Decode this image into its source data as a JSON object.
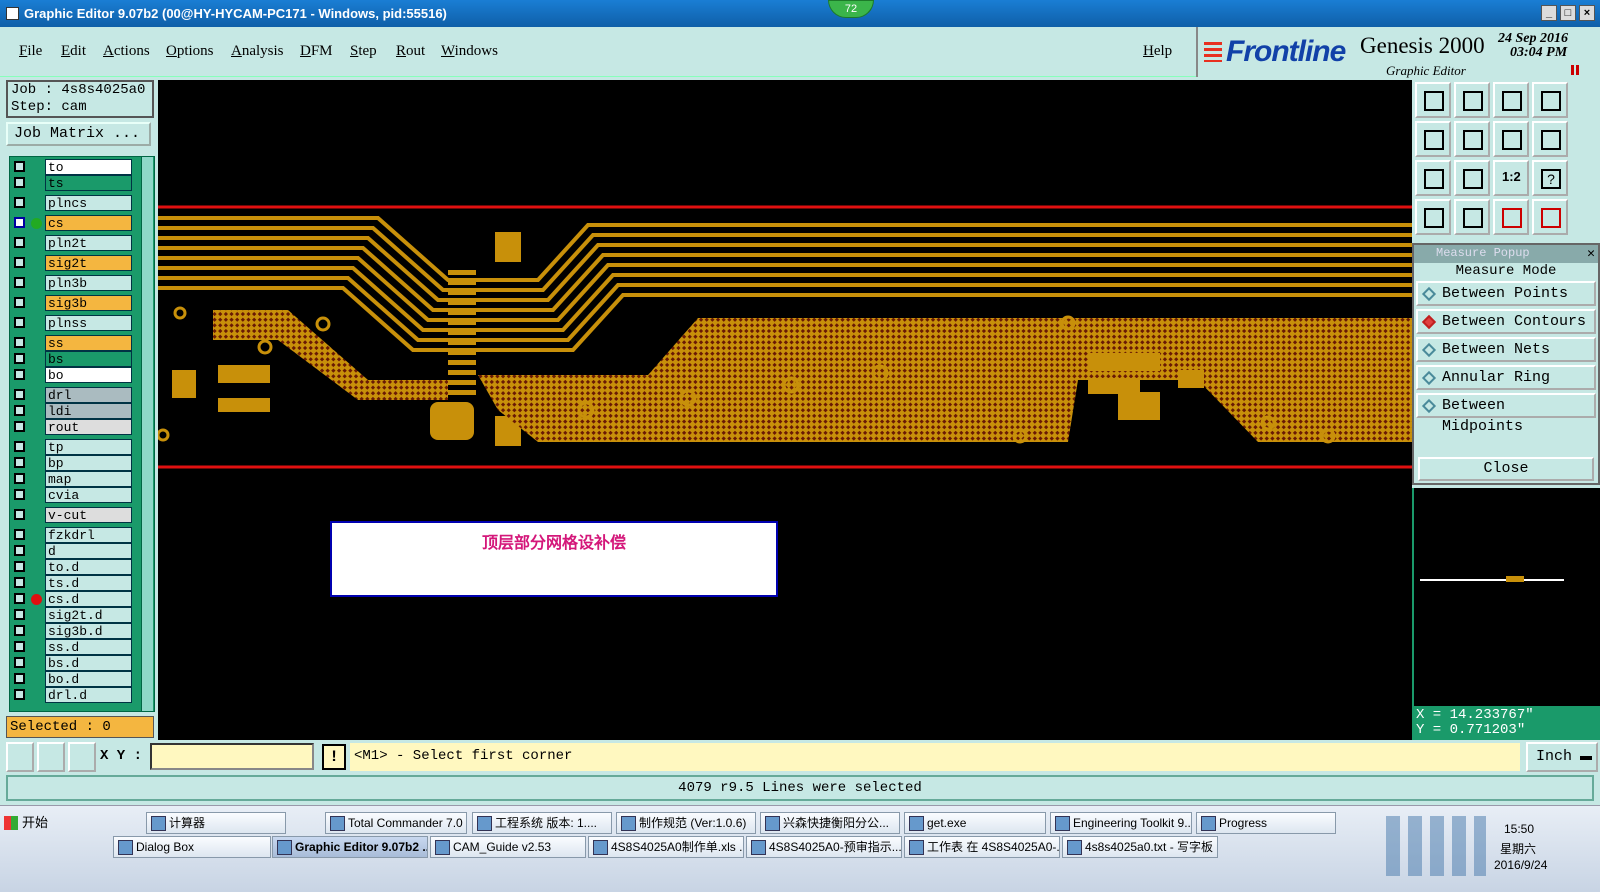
{
  "window": {
    "title": "Graphic Editor 9.07b2 (00@HY-HYCAM-PC171 - Windows, pid:55516)",
    "badge": "72"
  },
  "menu": {
    "items": [
      "File",
      "Edit",
      "Actions",
      "Options",
      "Analysis",
      "DFM",
      "Step",
      "Rout",
      "Windows"
    ],
    "help": "Help"
  },
  "brand": {
    "logo": "Frontline",
    "product": "Genesis 2000",
    "subtitle": "Graphic Editor",
    "date": "24 Sep 2016",
    "time": "03:04 PM"
  },
  "job": {
    "job_line": "Job : 4s8s4025a0",
    "step_line": "Step: cam",
    "matrix_btn": "Job Matrix ...",
    "selected": "Selected : 0"
  },
  "layers": [
    {
      "name": "to",
      "color": "#ffffff"
    },
    {
      "name": "ts",
      "color": "#1a9a6a"
    },
    {
      "name": "plncs",
      "color": "#c6e8e4"
    },
    {
      "name": "cs",
      "color": "#f4b640",
      "active": true
    },
    {
      "name": "pln2t",
      "color": "#c6e8e4"
    },
    {
      "name": "sig2t",
      "color": "#f4b640"
    },
    {
      "name": "pln3b",
      "color": "#c6e8e4"
    },
    {
      "name": "sig3b",
      "color": "#f4b640"
    },
    {
      "name": "plnss",
      "color": "#c6e8e4"
    },
    {
      "name": "ss",
      "color": "#f4b640"
    },
    {
      "name": "bs",
      "color": "#1a9a6a"
    },
    {
      "name": "bo",
      "color": "#ffffff"
    },
    {
      "name": "drl",
      "color": "#aabbc0"
    },
    {
      "name": "ldi",
      "color": "#aabbc0"
    },
    {
      "name": "rout",
      "color": "#dddddd"
    },
    {
      "name": "tp",
      "color": "#c6e8e4"
    },
    {
      "name": "bp",
      "color": "#c6e8e4"
    },
    {
      "name": "map",
      "color": "#c6e8e4"
    },
    {
      "name": "cvia",
      "color": "#c6e8e4"
    },
    {
      "name": "v-cut",
      "color": "#dddddd"
    },
    {
      "name": "fzkdrl",
      "color": "#c6e8e4"
    },
    {
      "name": "d",
      "color": "#c6e8e4"
    },
    {
      "name": "to.d",
      "color": "#c6e8e4"
    },
    {
      "name": "ts.d",
      "color": "#c6e8e4"
    },
    {
      "name": "cs.d",
      "color": "#c6e8e4",
      "red": true
    },
    {
      "name": "sig2t.d",
      "color": "#c6e8e4"
    },
    {
      "name": "sig3b.d",
      "color": "#c6e8e4"
    },
    {
      "name": "ss.d",
      "color": "#c6e8e4"
    },
    {
      "name": "bs.d",
      "color": "#c6e8e4"
    },
    {
      "name": "bo.d",
      "color": "#c6e8e4"
    },
    {
      "name": "drl.d",
      "color": "#c6e8e4"
    }
  ],
  "canvas": {
    "note": "顶层部分网格设补偿"
  },
  "measure": {
    "title": "Measure Popup",
    "mode_label": "Measure Mode",
    "options": [
      "Between Points",
      "Between Contours",
      "Between Nets",
      "Annular Ring",
      "Between Midpoints"
    ],
    "selected_index": 1,
    "close": "Close"
  },
  "coords": {
    "x": "X = 14.233767\"",
    "y": "Y = 0.771203\""
  },
  "bottom": {
    "xy_label": "X Y :",
    "prompt": "<M1> - Select first corner",
    "unit": "Inch"
  },
  "status": "4079 r9.5 Lines were selected",
  "taskbar": {
    "start": "开始",
    "row1": [
      "计算器",
      "Total Commander 7.0 ...",
      "工程系统  版本: 1....",
      "制作规范 (Ver:1.0.6)",
      "兴森快捷衡阳分公...",
      "get.exe",
      "Engineering Toolkit 9....",
      "Progress"
    ],
    "row2": [
      "Dialog Box",
      "Graphic Editor 9.07b2 ...",
      "CAM_Guide v2.53",
      "4S8S4025A0制作单.xls ...",
      "4S8S4025A0-预审指示....",
      "工作表 在 4S8S4025A0-...",
      "4s8s4025a0.txt - 写字板"
    ],
    "clock": "15:50",
    "weekday": "星期六",
    "date": "2016/9/24"
  }
}
